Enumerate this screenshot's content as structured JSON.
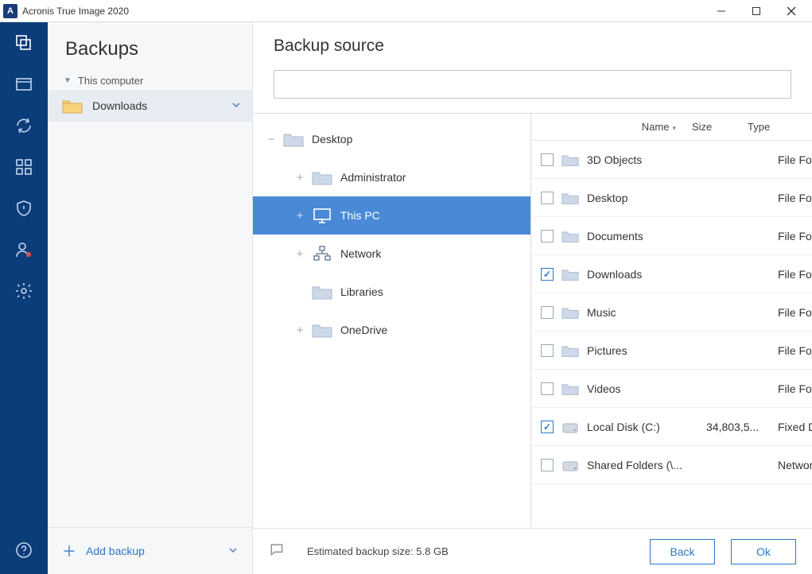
{
  "app_title": "Acronis True Image 2020",
  "sidebar": {
    "heading": "Backups",
    "group_label": "This computer",
    "item_label": "Downloads",
    "add_label": "Add backup"
  },
  "content": {
    "heading": "Backup source",
    "tree": [
      {
        "label": "Desktop",
        "icon": "folder",
        "level": 0,
        "tw": "−",
        "selected": false
      },
      {
        "label": "Administrator",
        "icon": "folder",
        "level": 1,
        "tw": "+",
        "selected": false
      },
      {
        "label": "This PC",
        "icon": "monitor",
        "level": 1,
        "tw": "+",
        "selected": true
      },
      {
        "label": "Network",
        "icon": "network",
        "level": 1,
        "tw": "+",
        "selected": false
      },
      {
        "label": "Libraries",
        "icon": "folder",
        "level": 1,
        "tw": "",
        "selected": false
      },
      {
        "label": "OneDrive",
        "icon": "folder",
        "level": 1,
        "tw": "+",
        "selected": false
      }
    ],
    "columns": {
      "name": "Name",
      "size": "Size",
      "type": "Type"
    },
    "rows": [
      {
        "name": "3D Objects",
        "icon": "folder",
        "checked": false,
        "size": "",
        "type": "File Fold"
      },
      {
        "name": "Desktop",
        "icon": "folder",
        "checked": false,
        "size": "",
        "type": "File Fold"
      },
      {
        "name": "Documents",
        "icon": "folder",
        "checked": false,
        "size": "",
        "type": "File Fold"
      },
      {
        "name": "Downloads",
        "icon": "folder",
        "checked": true,
        "size": "",
        "type": "File Fold"
      },
      {
        "name": "Music",
        "icon": "folder",
        "checked": false,
        "size": "",
        "type": "File Fold"
      },
      {
        "name": "Pictures",
        "icon": "folder",
        "checked": false,
        "size": "",
        "type": "File Fold"
      },
      {
        "name": "Videos",
        "icon": "folder",
        "checked": false,
        "size": "",
        "type": "File Fold"
      },
      {
        "name": "Local Disk (C:)",
        "icon": "disk",
        "checked": true,
        "size": "34,803,5...",
        "type": "Fixed D"
      },
      {
        "name": "Shared Folders (\\...",
        "icon": "disk",
        "checked": false,
        "size": "",
        "type": "Networ"
      }
    ]
  },
  "bottom": {
    "estimate": "Estimated backup size: 5.8 GB",
    "back": "Back",
    "ok": "Ok"
  }
}
